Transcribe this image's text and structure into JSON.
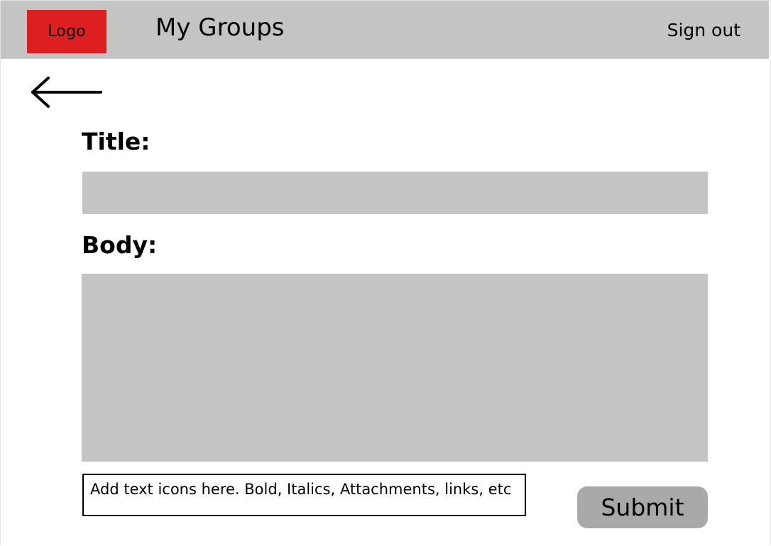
{
  "header": {
    "logo_label": "Logo",
    "title": "My Groups",
    "signout_label": "Sign out",
    "background": "#c4c4c4",
    "logo_color": "#dd1f1f"
  },
  "back_button": {
    "icon": "arrow-left-icon"
  },
  "form": {
    "title_label": "Title:",
    "title_value": "",
    "body_label": "Body:",
    "body_value": "",
    "toolbar_text": "Add text icons here. Bold, Italics, Attachments, links, etc",
    "submit_label": "Submit",
    "field_color": "#c4c4c4",
    "submit_color": "#a9a9a9"
  }
}
